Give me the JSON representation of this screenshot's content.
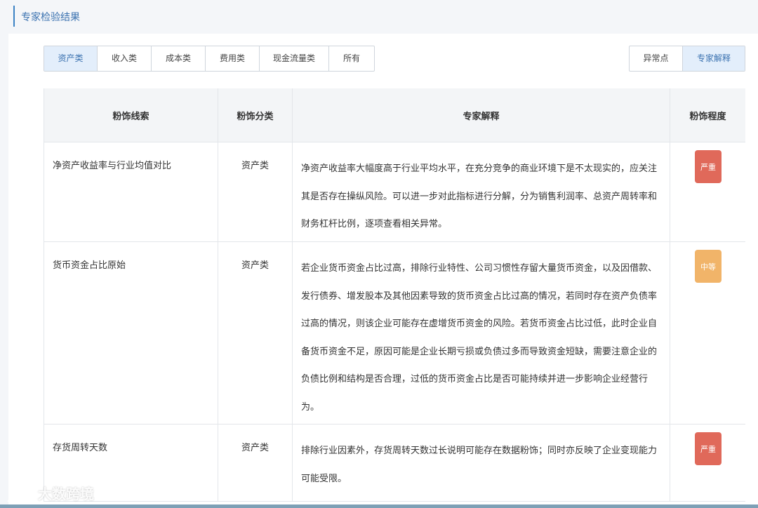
{
  "header": {
    "title": "专家检验结果"
  },
  "tabs": [
    {
      "label": "资产类",
      "active": true
    },
    {
      "label": "收入类",
      "active": false
    },
    {
      "label": "成本类",
      "active": false
    },
    {
      "label": "费用类",
      "active": false
    },
    {
      "label": "现金流量类",
      "active": false
    },
    {
      "label": "所有",
      "active": false
    }
  ],
  "view_toggle": {
    "anomaly": "异常点",
    "expert": "专家解释"
  },
  "table": {
    "headers": [
      "粉饰线索",
      "粉饰分类",
      "专家解释",
      "粉饰程度"
    ],
    "rows": [
      {
        "clue": "净资产收益率与行业均值对比",
        "category": "资产类",
        "explanation": "净资产收益率大幅度高于行业平均水平，在充分竞争的商业环境下是不太现实的，应关注其是否存在操纵风险。可以进一步对此指标进行分解，分为销售利润率、总资产周转率和财务杠杆比例，逐项查看相关异常。",
        "level": "严重",
        "level_color": "#e0695a"
      },
      {
        "clue": "货币资金占比原始",
        "category": "资产类",
        "explanation": "若企业货币资金占比过高，排除行业特性、公司习惯性存留大量货币资金，以及因借款、发行债券、增发股本及其他因素导致的货币资金占比过高的情况，若同时存在资产负债率过高的情况，则该企业可能存在虚增货币资金的风险。若货币资金占比过低，此时企业自备货币资金不足，原因可能是企业长期亏损或负债过多而导致资金短缺，需要注意企业的负债比例和结构是否合理，过低的货币资金占比是否可能持续并进一步影响企业经营行为。",
        "level": "中等",
        "level_color": "#f1b469"
      },
      {
        "clue": "存货周转天数",
        "category": "资产类",
        "explanation": "排除行业因素外，存货周转天数过长说明可能存在数据粉饰；同时亦反映了企业变现能力可能受限。",
        "level": "严重",
        "level_color": "#e0695a"
      }
    ]
  },
  "watermark": {
    "text": "大数跨境",
    "icon": "chat-bubble-logo"
  },
  "colors": {
    "accent": "#3b72b0",
    "active_bg": "#e3eefb",
    "severe": "#e0695a",
    "medium": "#f1b469"
  }
}
